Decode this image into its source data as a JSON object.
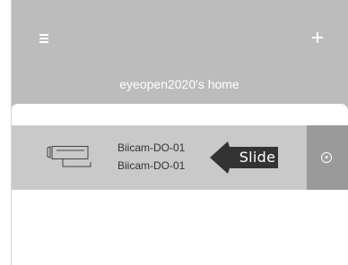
{
  "header": {
    "title": "eyeopen2020's home",
    "menu_icon": "menu-icon",
    "add_icon": "plus-icon"
  },
  "device": {
    "name": "Biicam-DO-01",
    "id": "Biicam-DO-01",
    "icon": "camera-icon",
    "delete_icon": "close-circle-icon"
  },
  "hint": {
    "label": "Slide"
  },
  "colors": {
    "header_bg": "#bcbcbc",
    "card_bg": "#c9c9c9",
    "delete_bg": "#9a9a9a",
    "hint_bg": "#333333"
  }
}
